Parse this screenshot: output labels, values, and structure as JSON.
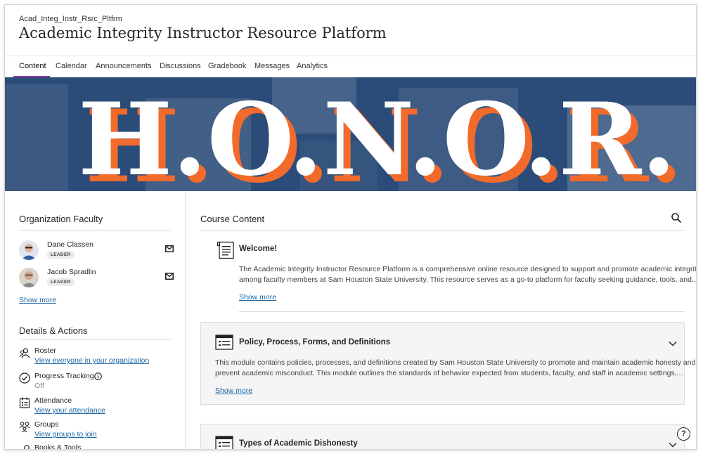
{
  "header": {
    "course_code": "Acad_Integ_Instr_Rsrc_Pltfrm",
    "course_title": "Academic Integrity Instructor Resource Platform"
  },
  "tabs": [
    {
      "label": "Content",
      "active": true
    },
    {
      "label": "Calendar"
    },
    {
      "label": "Announcements"
    },
    {
      "label": "Discussions"
    },
    {
      "label": "Gradebook"
    },
    {
      "label": "Messages"
    },
    {
      "label": "Analytics"
    }
  ],
  "banner": {
    "text": "H.O.N.O.R.",
    "colors": {
      "background": "#2b4c79",
      "letters": "#ffffff",
      "shadow": "#f26b2b"
    }
  },
  "faculty": {
    "title": "Organization Faculty",
    "members": [
      {
        "name": "Dane Classen",
        "role": "LEADER"
      },
      {
        "name": "Jacob Spradlin",
        "role": "LEADER"
      }
    ],
    "show_more": "Show more"
  },
  "details": {
    "title": "Details & Actions",
    "items": [
      {
        "icon": "roster-icon",
        "title": "Roster",
        "link": "View everyone in your organization"
      },
      {
        "icon": "progress-check-icon",
        "title": "Progress Tracking",
        "status": "Off"
      },
      {
        "icon": "attendance-icon",
        "title": "Attendance",
        "link": "View your attendance"
      },
      {
        "icon": "groups-icon",
        "title": "Groups",
        "link": "View groups to join"
      },
      {
        "icon": "tools-icon",
        "title": "Books & Tools"
      }
    ]
  },
  "content": {
    "title": "Course Content",
    "welcome": {
      "title": "Welcome!",
      "text_line1": "The Academic Integrity Instructor Resource Platform is a comprehensive online resource designed to support and promote academic integrity",
      "text_line2": "among faculty members at Sam Houston State University. This resource serves as a go-to platform for faculty seeking guidance, tools, and...",
      "show_more": "Show more"
    },
    "modules": [
      {
        "title": "Policy, Process, Forms, and Definitions",
        "text_line1": "This module contains policies, processes, and definitions created by Sam Houston State University to promote and maintain academic honesty and",
        "text_line2": "prevent academic misconduct. This module outlines the standards of behavior expected from students, faculty, and staff in academic settings,...",
        "show_more": "Show more"
      },
      {
        "title": "Types of Academic Dishonesty"
      }
    ]
  },
  "help": {
    "label": "?"
  },
  "colors": {
    "accent": "#8a3aa3",
    "link": "#1d67a7"
  }
}
